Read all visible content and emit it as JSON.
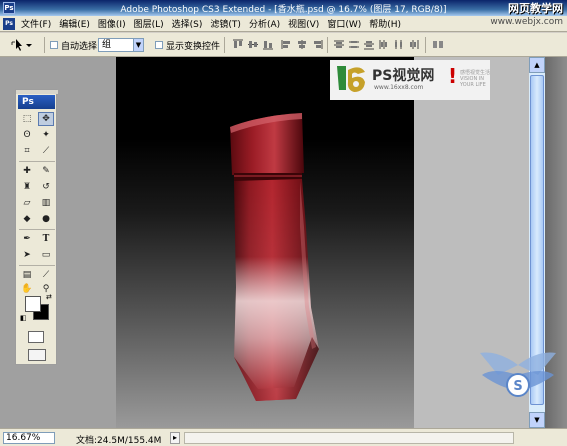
{
  "window": {
    "title": "Adobe Photoshop CS3 Extended - [香水瓶.psd @ 16.7% (图层 17, RGB/8)]",
    "brand_badge": "网页教学网"
  },
  "menubar": {
    "items": [
      "文件(F)",
      "编辑(E)",
      "图像(I)",
      "图层(L)",
      "选择(S)",
      "滤镜(T)",
      "分析(A)",
      "视图(V)",
      "窗口(W)",
      "帮助(H)"
    ],
    "url_tag": "www.webjx.com"
  },
  "options": {
    "auto_select_label": "自动选择:",
    "auto_select_value": "组",
    "show_transform_label": "显示变换控件"
  },
  "watermark": {
    "logo": "16",
    "title": "PS视觉网",
    "url": "www.16xx8.com",
    "tagline": "感悟视觉生活 VISION IN YOUR LIFE"
  },
  "tools": {
    "panel_label": "Ps"
  },
  "status": {
    "zoom": "16.67%",
    "doc_size": "文档:24.5M/155.4M"
  },
  "colors": {
    "bottle_dark": "#5a0a10",
    "bottle_mid": "#a01c26",
    "bottle_light": "#e8c8c8",
    "accent": "#0a246a"
  }
}
